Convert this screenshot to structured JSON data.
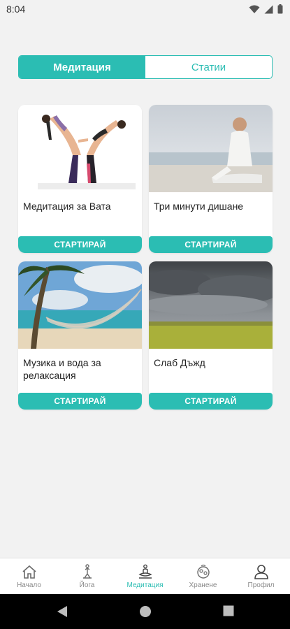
{
  "status": {
    "time": "8:04"
  },
  "segments": {
    "active": "Медитация",
    "inactive": "Статии"
  },
  "cards": [
    {
      "title": "Медитация за Вата",
      "button": "СТАРТИРАЙ"
    },
    {
      "title": "Три минути дишане",
      "button": "СТАРТИРАЙ"
    },
    {
      "title": "Музика и вода за релаксация",
      "button": "СТАРТИРАЙ"
    },
    {
      "title": "Слаб Дъжд",
      "button": "СТАРТИРАЙ"
    }
  ],
  "nav": [
    {
      "label": "Начало",
      "icon": "home-icon"
    },
    {
      "label": "Йога",
      "icon": "yoga-icon"
    },
    {
      "label": "Медитация",
      "icon": "meditation-icon",
      "active": true
    },
    {
      "label": "Хранене",
      "icon": "food-icon"
    },
    {
      "label": "Профил",
      "icon": "profile-icon"
    }
  ],
  "colors": {
    "accent": "#2bbdb3",
    "inactive": "#8a8a8a",
    "background": "#f2f2f2"
  }
}
